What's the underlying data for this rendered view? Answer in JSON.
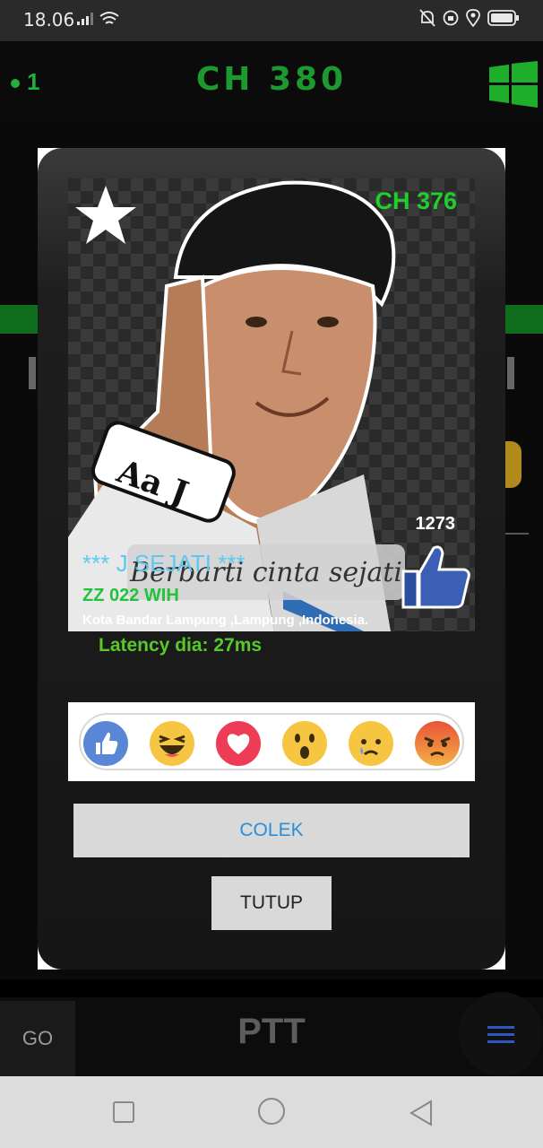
{
  "status_bar": {
    "time": "18.06"
  },
  "app_bar": {
    "online_count": "1",
    "channel_title": "CH 380"
  },
  "profile": {
    "channel": "CH 376",
    "likes": "1273",
    "name": "*** J SEJATI ***",
    "callsign": "ZZ 022 WIH",
    "location": "Kota Bandar Lampung ,Lampung ,Indonesia.",
    "status_text": "Berbarti cinta sejati",
    "badge_text": "Aa J"
  },
  "latency": "Latency dia: 27ms",
  "reactions": [
    "like",
    "haha",
    "love",
    "wow",
    "sad",
    "angry"
  ],
  "buttons": {
    "colek": "COLEK",
    "tutup": "TUTUP"
  },
  "bottom": {
    "go": "GO",
    "ptt": "PTT"
  },
  "colors": {
    "accent_green": "#1d9a2f",
    "link_blue": "#2a8fd8",
    "name_cyan": "#5ec8f0"
  }
}
